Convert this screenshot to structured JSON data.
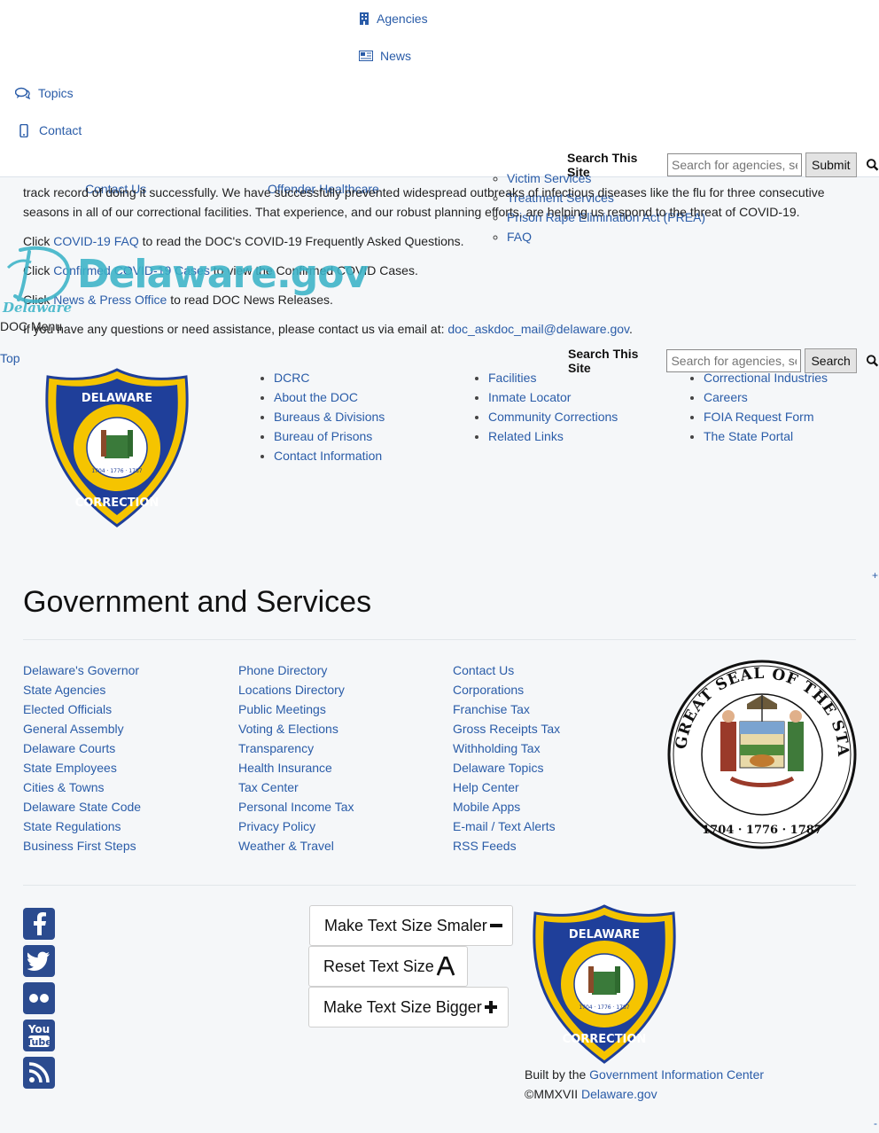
{
  "nav": {
    "agencies": "Agencies",
    "news": "News",
    "topics": "Topics",
    "contact": "Contact"
  },
  "search_top": {
    "label": "Search This Site",
    "placeholder": "Search for agencies, se",
    "button": "Submit"
  },
  "search_bottom": {
    "label": "Search This Site",
    "placeholder": "Search for agencies, se",
    "button": "Search"
  },
  "overlaps": {
    "contact_us": "Contact Us",
    "offender_healthcare": "Offender Healthcare",
    "victim_services": "Victim Services",
    "treatment_services": "Treatment Services",
    "prea": "Prison Rape Elimination Act (PREA)",
    "faq": "FAQ"
  },
  "content": {
    "line1": "track record of doing it successfully. We have successfully prevented widespread outbreaks of infectious diseases like the flu for three consecutive",
    "line2": "seasons in all of our correctional facilities. That experience, and our robust planning efforts, are helping us respond to the threat of COVID-19.",
    "p_faq_pre": "Click ",
    "p_faq_link": "COVID-19 FAQ",
    "p_faq_post": " to read the DOC's COVID-19 Frequently Asked Questions.",
    "p_cases_pre": "Click ",
    "p_cases_link": "Confirmed COVID-19 Cases",
    "p_cases_post": " to view the Confirmed COVID Cases.",
    "p_news_pre": "Click ",
    "p_news_link": "News & Press Office",
    "p_news_post": " to read DOC News Releases.",
    "p_email_pre": "If you have any questions or need assistance, please contact us via email at: ",
    "p_email_link": "doc_askdoc_mail@delaware.gov",
    "p_email_post": "."
  },
  "brand": {
    "logo_text": "Delaware.gov",
    "script_text": "Delaware"
  },
  "doc_menu": "DOC Menu",
  "top_link": "Top",
  "doc_links": {
    "col1": [
      "DCRC",
      "About the DOC",
      "Bureaus & Divisions",
      "Bureau of Prisons",
      "Contact Information"
    ],
    "col2": [
      "Facilities",
      "Inmate Locator",
      "Community Corrections",
      "Related Links"
    ],
    "col3": [
      "Correctional Industries",
      "Careers",
      "FOIA Request Form",
      "The State Portal"
    ]
  },
  "badge": {
    "top": "DELAWARE",
    "bottom": "CORRECTION"
  },
  "plus_marker": "+",
  "minus_marker": "-",
  "gov": {
    "title": "Government and Services",
    "col1": [
      "Delaware's Governor",
      "State Agencies",
      "Elected Officials",
      "General Assembly",
      "Delaware Courts",
      "State Employees",
      "Cities & Towns",
      "Delaware State Code",
      "State Regulations",
      "Business First Steps"
    ],
    "col2": [
      "Phone Directory",
      "Locations Directory",
      "Public Meetings",
      "Voting & Elections",
      "Transparency",
      "Health Insurance",
      "Tax Center",
      "Personal Income Tax",
      "Privacy Policy",
      "Weather & Travel"
    ],
    "col3": [
      "Contact Us",
      "Corporations",
      "Franchise Tax",
      "Gross Receipts Tax",
      "Withholding Tax",
      "Delaware Topics",
      "Help Center",
      "Mobile Apps",
      "E-mail / Text Alerts",
      "RSS Feeds"
    ]
  },
  "seal": {
    "ring_text": "GREAT SEAL OF THE STATE OF DELAWARE",
    "years": "1704 · 1776 · 1787"
  },
  "text_size": {
    "smaller": "Make Text Size Smaler",
    "reset": "Reset Text Size",
    "bigger": "Make Text Size Bigger"
  },
  "footer": {
    "built_pre": "Built by the ",
    "built_link": "Government Information Center",
    "copy_pre": "©MMXVII ",
    "copy_link": "Delaware.gov"
  },
  "colors": {
    "link": "#2a5ca8",
    "badge_blue": "#1f3f9a",
    "badge_gold": "#f5c400",
    "social": "#2b4b8f"
  }
}
